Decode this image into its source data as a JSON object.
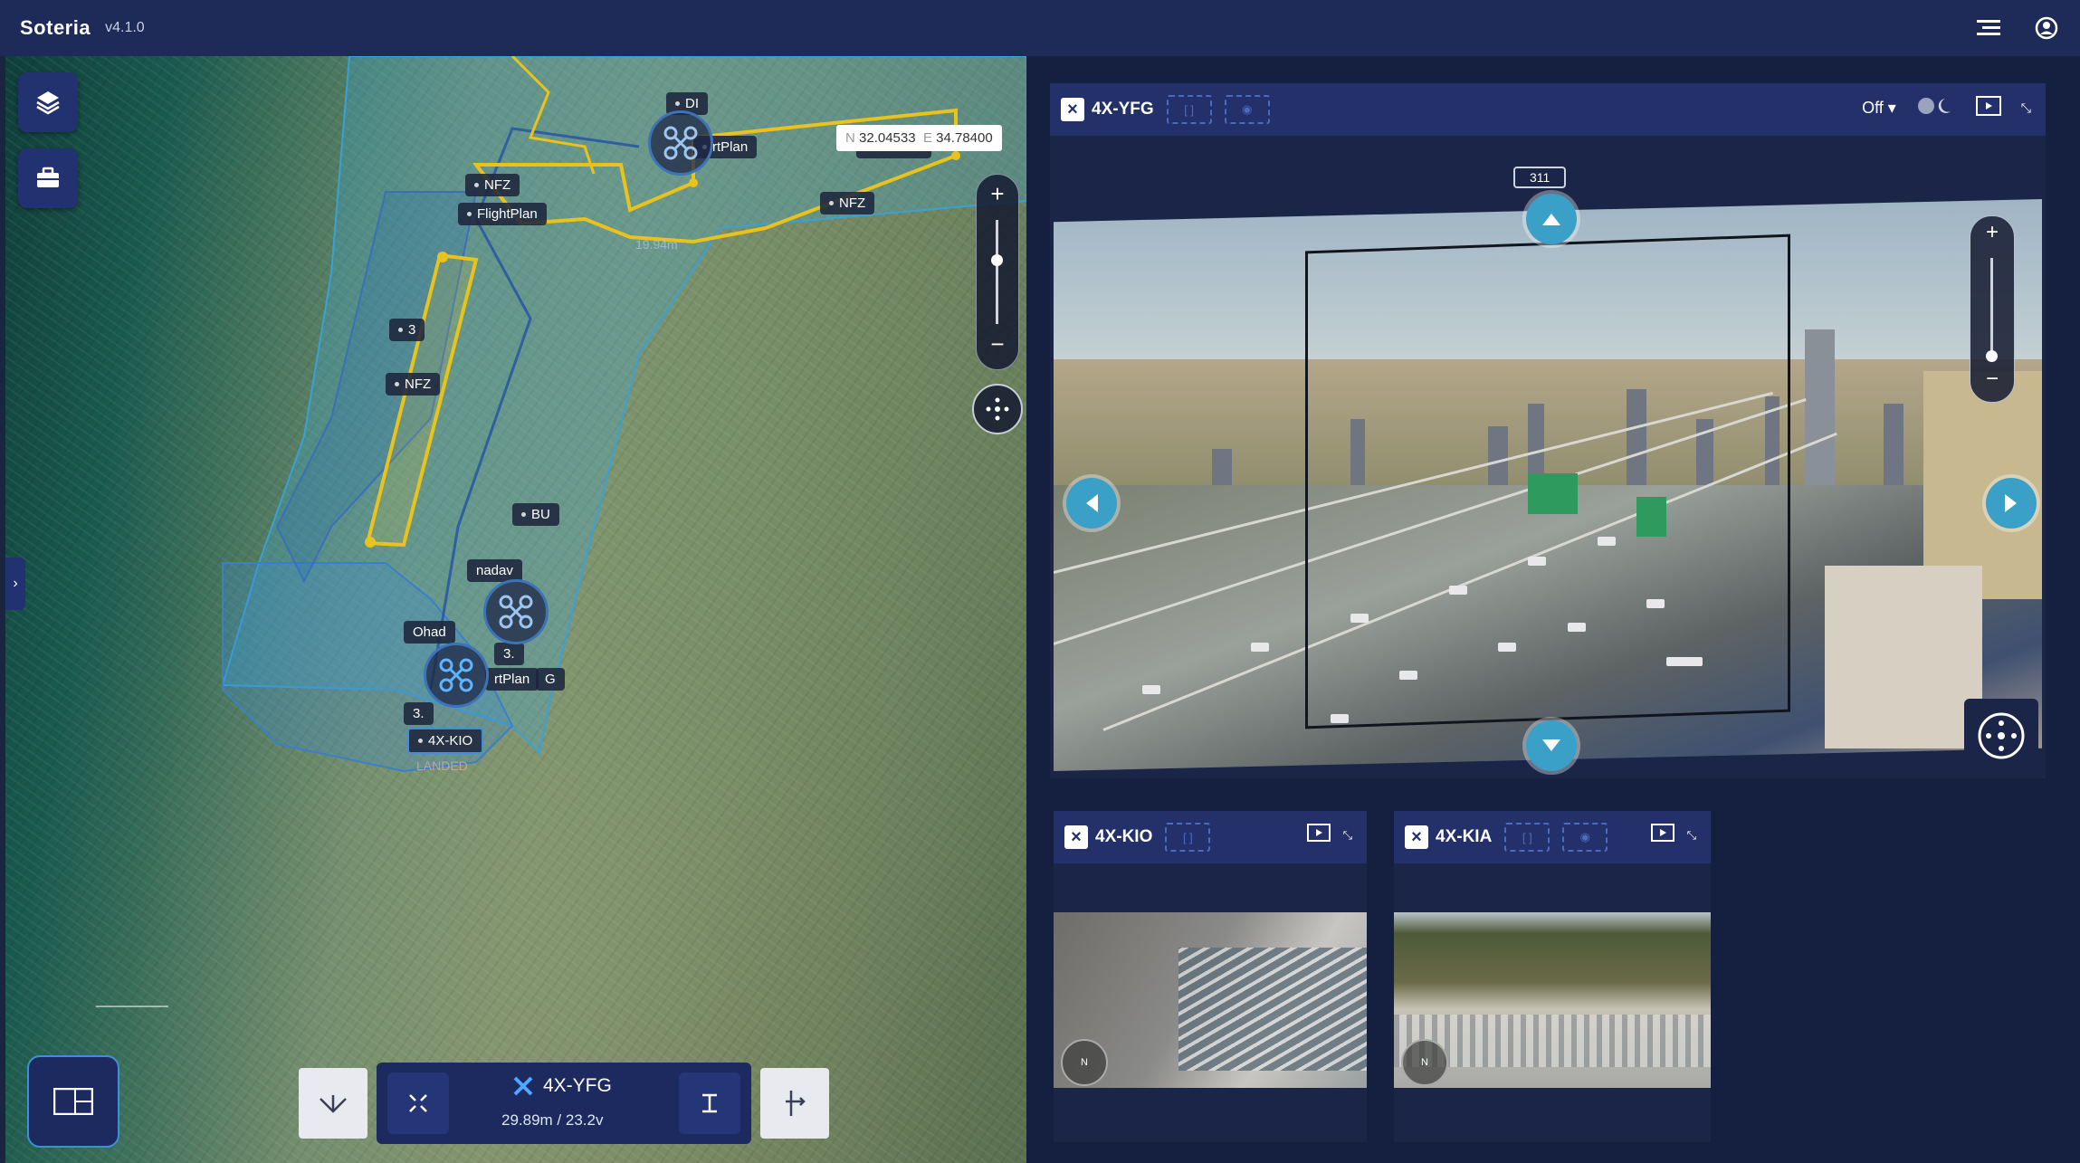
{
  "app": {
    "name": "Soteria",
    "version": "v4.1.0"
  },
  "header_icons": [
    "menu-icon",
    "user-circle-icon"
  ],
  "map": {
    "coords": {
      "n_prefix": "N",
      "n_value": "32.04533",
      "e_prefix": "E",
      "e_value": "34.78400"
    },
    "labels": {
      "nfz_1": "NFZ",
      "flightplan_1": "FlightPlan",
      "plan_top": "rtPlan",
      "south": "1 South",
      "nfz_2": "NFZ",
      "label_3a": "3",
      "nfz_3": "NFZ",
      "bu": "BU",
      "nadav": "nadav",
      "ohad": "Ohad",
      "label_3b": "3.",
      "flightplan_2": "rtPlan",
      "label_g": "G",
      "label_3c": "3.",
      "kio": "4X-KIO",
      "landed": "LANDED",
      "dist": "19.94m",
      "di": "DI"
    },
    "controls": {
      "drone_name": "4X-YFG",
      "stats": "29.89m / 23.2v"
    },
    "icons": [
      "layers-icon",
      "toolbox-icon",
      "collapse-chevron-icon",
      "layout-grid-icon",
      "zoom-in-icon",
      "zoom-out-icon",
      "recenter-icon"
    ]
  },
  "video": {
    "main": {
      "title": "4X-YFG",
      "mode": "Off",
      "tag": "311"
    },
    "small": [
      {
        "title": "4X-KIO"
      },
      {
        "title": "4X-KIA"
      }
    ]
  },
  "colors": {
    "accent": "#3f8fd6",
    "topbar": "#1e2a58",
    "panel": "#23306a",
    "nfz": "#e9c21b",
    "zone": "#3aa0d8"
  }
}
